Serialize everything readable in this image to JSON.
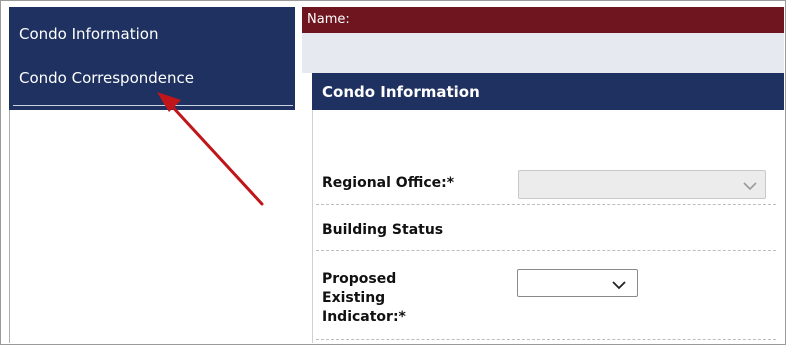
{
  "sidebar": {
    "items": [
      {
        "label": "Condo Information"
      },
      {
        "label": "Condo Correspondence"
      }
    ]
  },
  "header": {
    "name_label": "Name:"
  },
  "panel": {
    "title": "Condo Information",
    "fields": [
      {
        "label": "Regional Office:*",
        "control": "select",
        "disabled": true,
        "value": ""
      },
      {
        "label": "Building Status",
        "control": "none"
      },
      {
        "label_lines": [
          "Proposed",
          "Existing",
          "Indicator:*"
        ],
        "control": "select",
        "disabled": false,
        "value": ""
      }
    ]
  },
  "colors": {
    "navy": "#1f3161",
    "maroon": "#6e1520",
    "annotation_arrow": "#c0161a"
  },
  "annotation": {
    "type": "arrow",
    "points_to": "Condo Correspondence"
  }
}
